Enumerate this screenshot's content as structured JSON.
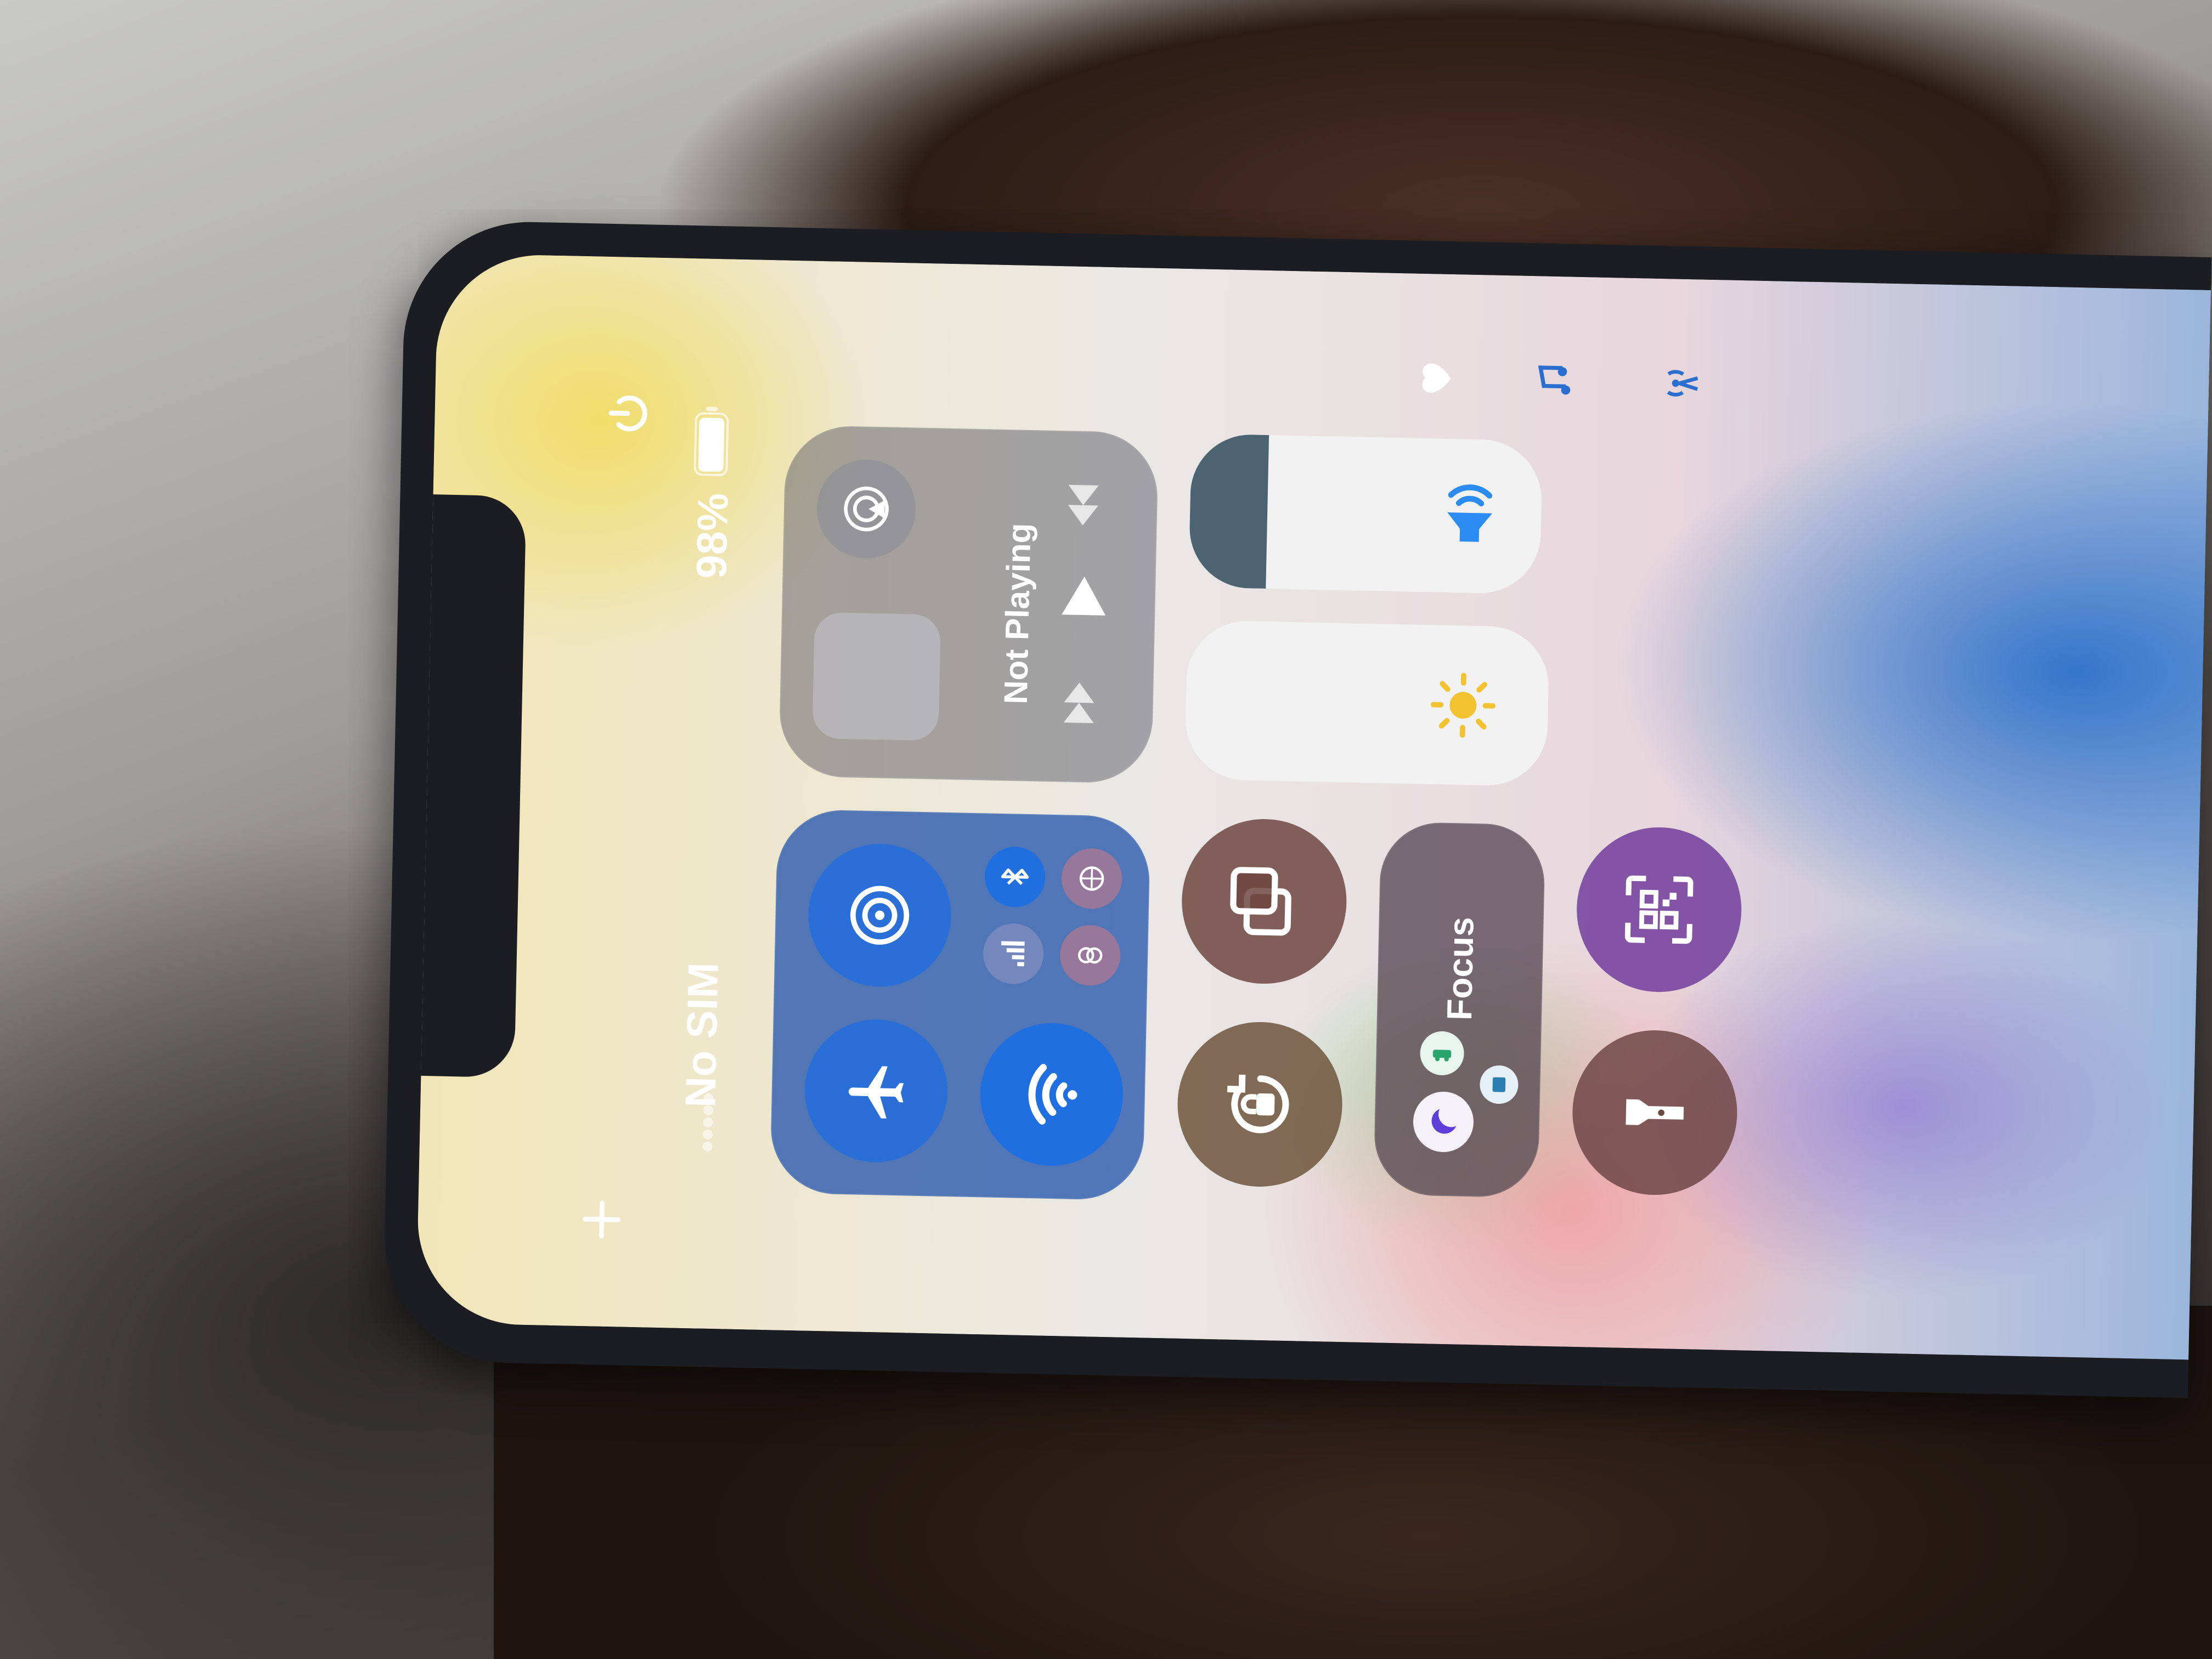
{
  "status_bar": {
    "carrier": "No SIM",
    "battery_percent": "98%",
    "battery_level": 0.98
  },
  "connectivity": {
    "airplane_mode": false,
    "airdrop": true,
    "wifi": true,
    "bluetooth": true
  },
  "now_playing": {
    "title": "Not Playing"
  },
  "focus": {
    "label": "Focus"
  },
  "sliders": {
    "brightness_level": 0.0,
    "volume_level": 0.22
  },
  "colors": {
    "active_blue": "#1f6fe0",
    "tile_dark": "#4a4a55",
    "brown_tile": "#6b4a44",
    "purple_tile": "#7a4aa8",
    "sun_yellow": "#f2c230",
    "speaker_blue": "#2a8cf0"
  },
  "icons": [
    "power-icon",
    "plus-icon",
    "heart-icon",
    "music-note-icon",
    "signal-tower-icon",
    "airplay-icon",
    "play-icon",
    "skip-back-icon",
    "skip-forward-icon",
    "speaker-icon",
    "sun-icon",
    "airplane-icon",
    "airdrop-icon",
    "wifi-icon",
    "cellular-icon",
    "bluetooth-icon",
    "vpn-icon",
    "screen-mirror-icon",
    "rotation-lock-icon",
    "moon-icon",
    "qr-code-icon",
    "flashlight-icon"
  ]
}
